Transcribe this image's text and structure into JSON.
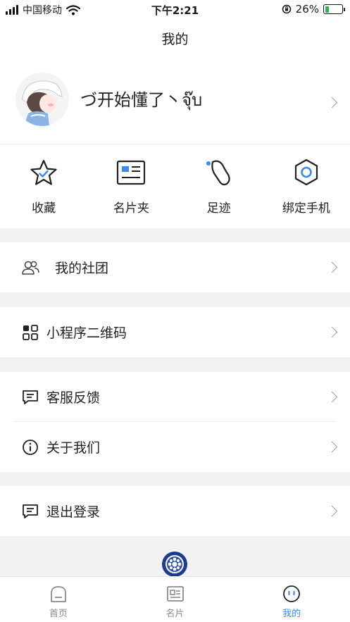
{
  "status_bar": {
    "carrier": "中国移动",
    "time": "下午2:21",
    "battery": "26%",
    "battery_level": 0.26
  },
  "nav": {
    "title": "我的"
  },
  "profile": {
    "username": "づ开始懂了丶จุ๊บ"
  },
  "quick_actions": [
    {
      "label": "收藏",
      "icon": "star-icon"
    },
    {
      "label": "名片夹",
      "icon": "card-holder-icon"
    },
    {
      "label": "足迹",
      "icon": "footprint-icon"
    },
    {
      "label": "绑定手机",
      "icon": "hexagon-icon"
    }
  ],
  "menu": {
    "clubs": "我的社团",
    "qrcode": "小程序二维码",
    "feedback": "客服反馈",
    "about": "关于我们",
    "logout": "退出登录"
  },
  "tabbar": {
    "items": [
      {
        "label": "首页",
        "icon": "home-icon"
      },
      {
        "label": "名片",
        "icon": "card-icon"
      },
      {
        "label": "我的",
        "icon": "profile-face-icon"
      }
    ],
    "active": "我的",
    "active_color": "#3b8beb"
  },
  "colors": {
    "accent": "#3b8beb",
    "background": "#f2f2f3"
  }
}
